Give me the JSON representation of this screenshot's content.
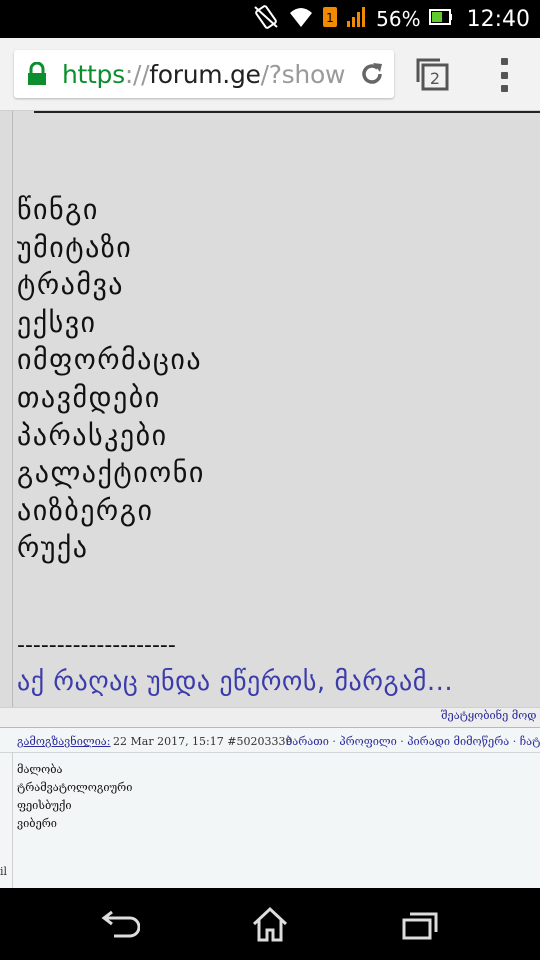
{
  "status": {
    "battery": "56%",
    "time": "12:40",
    "sim_badge": "1"
  },
  "browser": {
    "url_scheme": "https",
    "url_sep": "://",
    "url_host": "forum.ge",
    "url_path": "/?show",
    "tab_count": "2"
  },
  "post": {
    "words": [
      "წინგი",
      "უმიტაზი",
      "ტრამვა",
      "ექსვი",
      "იმფორმაცია",
      "თავმდები",
      "პარასკები",
      "გალაქტიონი",
      "აიზბერგი",
      "რუქა"
    ],
    "separator": "--------------------",
    "signature": "აქ რაღაც უნდა ეწეროს, მარგამ..."
  },
  "quote_strip": {
    "link": "შეატყობინე მოდ"
  },
  "post2": {
    "sender_label": "გამოგზავნილია:",
    "date": "22 Mar 2017, 15:17",
    "post_id": "#50203339",
    "actions": "ბარათი · პროფილი · პირადი მიმოწერა · ჩატი",
    "lines": [
      "მალობა",
      "ტრამვატოლოგიური",
      "ფეისბუქი",
      "ვიბერი"
    ],
    "left_clip": "il"
  },
  "colors": {
    "url_green": "#0b8f2e",
    "link_blue": "#2b2b9a",
    "signature_blue": "#3b3bab",
    "post_bg": "#dcdcdc"
  }
}
